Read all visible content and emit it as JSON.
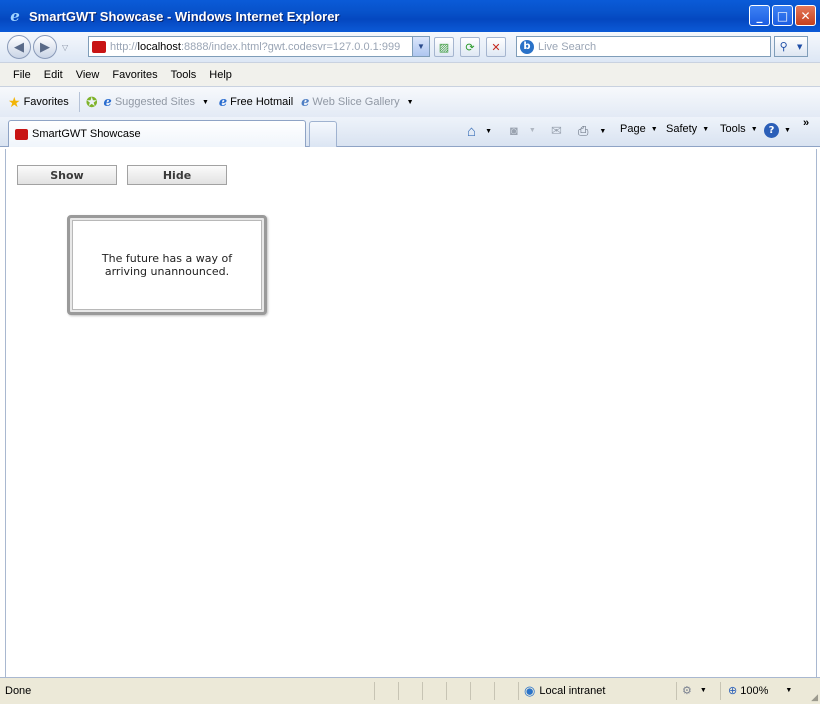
{
  "window": {
    "title": "SmartGWT Showcase - Windows Internet Explorer"
  },
  "address": {
    "prefix": "http://",
    "host": "localhost",
    "rest": ":8888/index.html?gwt.codesvr=127.0.0.1:999"
  },
  "search": {
    "placeholder": "Live Search"
  },
  "menu": [
    "File",
    "Edit",
    "View",
    "Favorites",
    "Tools",
    "Help"
  ],
  "favorites": {
    "label": "Favorites",
    "items": [
      "Suggested Sites",
      "Free Hotmail",
      "Web Slice Gallery"
    ]
  },
  "tab": {
    "label": "SmartGWT Showcase"
  },
  "commands": {
    "page": "Page",
    "safety": "Safety",
    "tools": "Tools"
  },
  "content": {
    "show_label": "Show",
    "hide_label": "Hide",
    "card_text": "The future has a way of arriving unannounced."
  },
  "status": {
    "text": "Done",
    "zone": "Local intranet",
    "zoom": "100%"
  }
}
